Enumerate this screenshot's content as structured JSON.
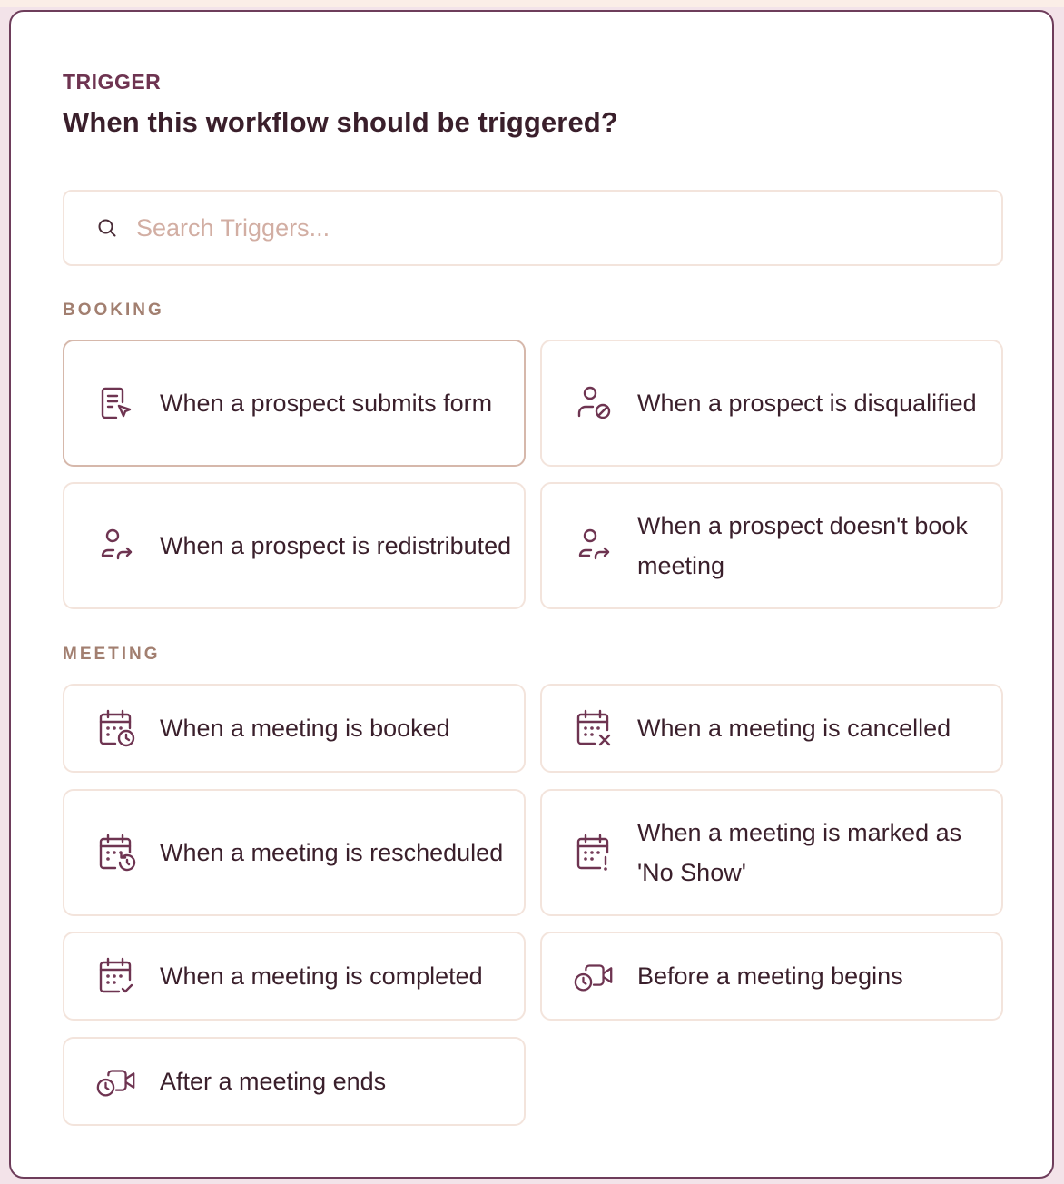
{
  "header": {
    "eyebrow": "TRIGGER",
    "title": "When this workflow should be triggered?"
  },
  "search": {
    "placeholder": "Search Triggers...",
    "value": ""
  },
  "sections": {
    "booking": {
      "label": "BOOKING",
      "items": [
        {
          "label": "When a prospect submits form",
          "icon": "form-submit-icon",
          "selected": true
        },
        {
          "label": "When a prospect is disqualified",
          "icon": "user-blocked-icon",
          "selected": false
        },
        {
          "label": "When a prospect is redistributed",
          "icon": "user-redistribute-icon",
          "selected": false
        },
        {
          "label": "When a prospect doesn't book meeting",
          "icon": "user-redistribute-icon",
          "selected": false
        }
      ]
    },
    "meeting": {
      "label": "MEETING",
      "items": [
        {
          "label": "When a meeting is booked",
          "icon": "calendar-clock-icon"
        },
        {
          "label": "When a meeting is cancelled",
          "icon": "calendar-x-icon"
        },
        {
          "label": "When a meeting is rescheduled",
          "icon": "calendar-reschedule-icon"
        },
        {
          "label": "When a meeting is marked as 'No Show'",
          "icon": "calendar-alert-icon"
        },
        {
          "label": "When a meeting is completed",
          "icon": "calendar-check-icon"
        },
        {
          "label": "Before a meeting begins",
          "icon": "video-clock-icon"
        },
        {
          "label": "After a meeting ends",
          "icon": "video-clock-icon"
        }
      ]
    }
  },
  "colors": {
    "accent": "#6e3451",
    "text": "#3a1f2b",
    "section_label": "#a27f70",
    "card_border": "#f3e4dc",
    "selected_border": "#d6b8ab",
    "placeholder": "#d2aea3"
  }
}
